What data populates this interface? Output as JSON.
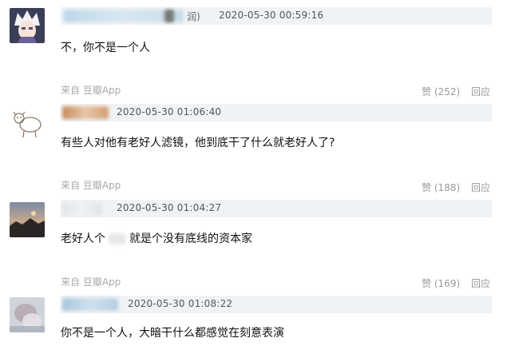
{
  "comments": [
    {
      "time": "2020-05-30 00:59:16",
      "meta_suffix": "润)",
      "text": "不，你不是一个人",
      "source": "来自 豆瓣App",
      "like_label": "赞 (252)",
      "reply_label": "回应"
    },
    {
      "time": "2020-05-30 01:06:40",
      "text": "有些人对他有老好人滤镜，他到底干了什么就老好人了?",
      "source": "来自 豆瓣App",
      "like_label": "赞 (188)",
      "reply_label": "回应"
    },
    {
      "time": "2020-05-30 01:04:27",
      "text_part1": "老好人个",
      "text_part2": "就是个没有底线的资本家",
      "source": "来自 豆瓣App",
      "like_label": "赞 (169)",
      "reply_label": "回应"
    },
    {
      "time": "2020-05-30 01:08:22",
      "text": "你不是一个人，大暗干什么都感觉在刻意表演"
    }
  ],
  "colors": {
    "meta_bar": "#f0f3f5",
    "action_text": "#999999",
    "source_text": "#aaaaaa"
  },
  "icons": [
    "avatar-anime",
    "avatar-sketch-sheep",
    "avatar-landscape",
    "avatar-blurred"
  ]
}
